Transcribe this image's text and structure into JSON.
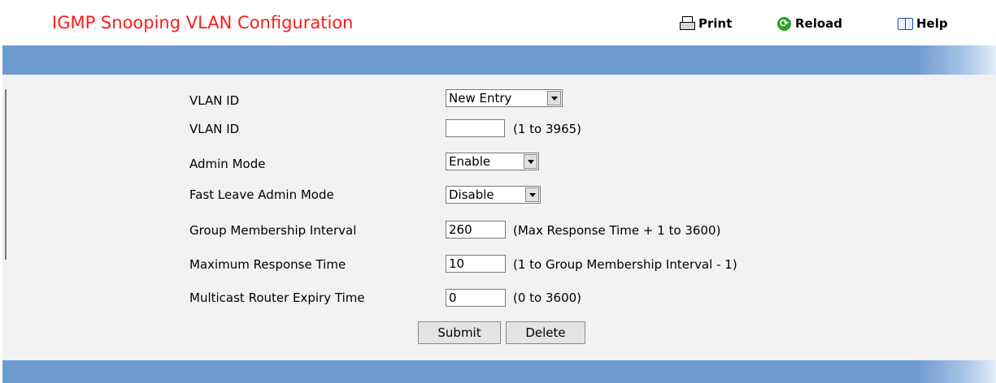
{
  "header": {
    "title": "IGMP Snooping VLAN Configuration",
    "print_label": "Print",
    "reload_label": "Reload",
    "help_label": "Help"
  },
  "colors": {
    "title": "#ff1a1a",
    "bar": "#6e9bd0",
    "content_bg": "#f2f2f2"
  },
  "form": {
    "vlan_select": {
      "label": "VLAN ID",
      "value": "New Entry"
    },
    "vlan_id": {
      "label": "VLAN ID",
      "value": "",
      "hint": "(1 to 3965)"
    },
    "admin_mode": {
      "label": "Admin Mode",
      "value": "Enable"
    },
    "fast_leave": {
      "label": "Fast Leave Admin Mode",
      "value": "Disable"
    },
    "group_membership": {
      "label": "Group Membership Interval",
      "value": "260",
      "hint": "(Max Response Time + 1 to 3600)"
    },
    "max_response": {
      "label": "Maximum Response Time",
      "value": "10",
      "hint": "(1 to Group Membership Interval - 1)"
    },
    "router_expiry": {
      "label": "Multicast Router Expiry Time",
      "value": "0",
      "hint": "(0 to 3600)"
    }
  },
  "buttons": {
    "submit": "Submit",
    "delete": "Delete"
  }
}
